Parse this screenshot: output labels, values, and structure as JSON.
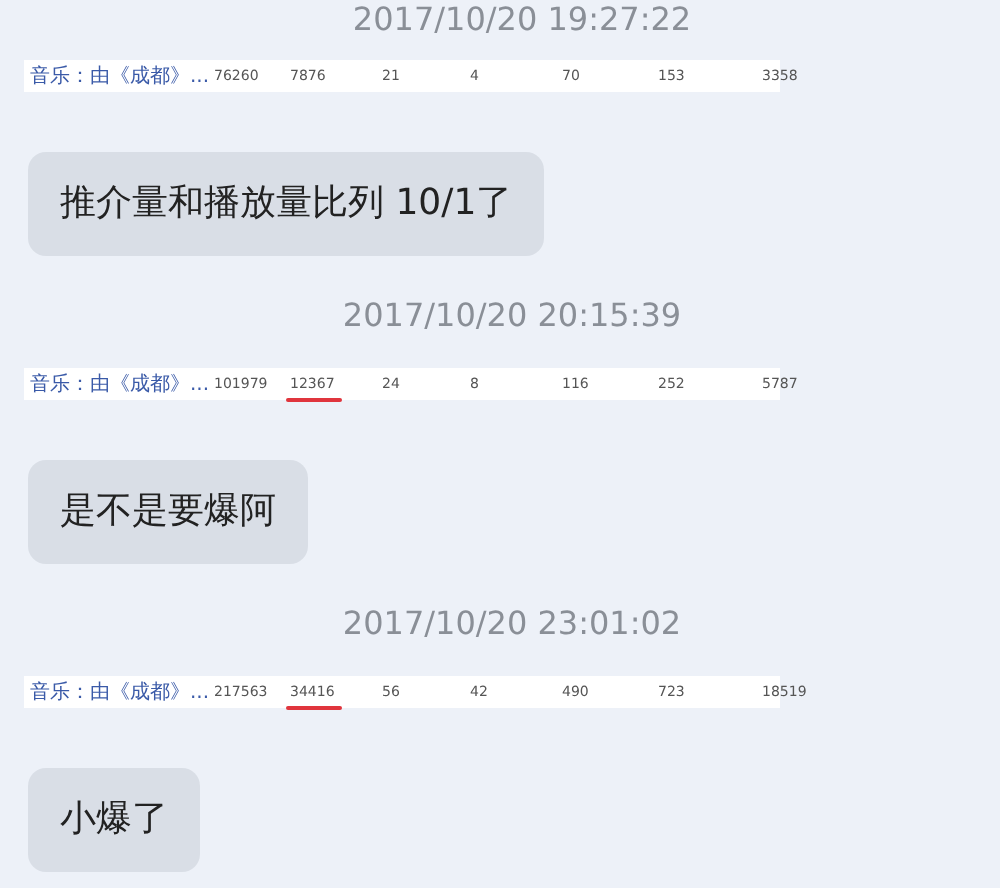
{
  "items": [
    {
      "kind": "time",
      "text": "2017/10/20 19:27:22"
    },
    {
      "kind": "stats",
      "label": "音乐：由《成都》...",
      "values": [
        {
          "text": "76260",
          "marked": false
        },
        {
          "text": "7876",
          "marked": false
        },
        {
          "text": "21",
          "marked": false
        },
        {
          "text": "4",
          "marked": false
        },
        {
          "text": "70",
          "marked": false
        },
        {
          "text": "153",
          "marked": false
        },
        {
          "text": "3358",
          "marked": false
        }
      ]
    },
    {
      "kind": "message",
      "text": "推介量和播放量比列 10/1了"
    },
    {
      "kind": "time",
      "text": "2017/10/20 20:15:39"
    },
    {
      "kind": "stats",
      "label": "音乐：由《成都》...",
      "values": [
        {
          "text": "101979",
          "marked": false
        },
        {
          "text": "12367",
          "marked": true
        },
        {
          "text": "24",
          "marked": false
        },
        {
          "text": "8",
          "marked": false
        },
        {
          "text": "116",
          "marked": false
        },
        {
          "text": "252",
          "marked": false
        },
        {
          "text": "5787",
          "marked": false
        }
      ]
    },
    {
      "kind": "message",
      "text": "是不是要爆阿"
    },
    {
      "kind": "time",
      "text": "2017/10/20 23:01:02"
    },
    {
      "kind": "stats",
      "label": "音乐：由《成都》...",
      "values": [
        {
          "text": "217563",
          "marked": false
        },
        {
          "text": "34416",
          "marked": true
        },
        {
          "text": "56",
          "marked": false
        },
        {
          "text": "42",
          "marked": false
        },
        {
          "text": "490",
          "marked": false
        },
        {
          "text": "723",
          "marked": false
        },
        {
          "text": "18519",
          "marked": false
        }
      ]
    },
    {
      "kind": "message",
      "text": "小爆了"
    }
  ]
}
